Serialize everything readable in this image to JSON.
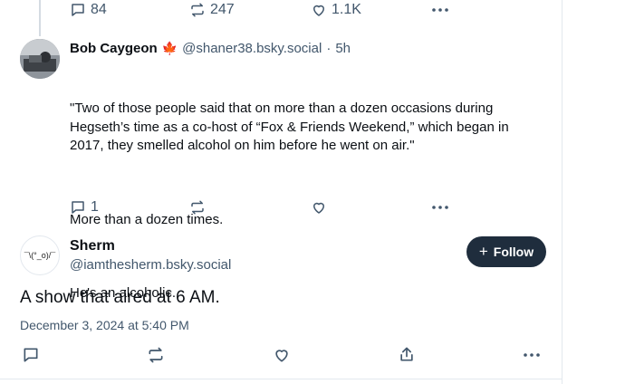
{
  "top_actions": {
    "replies": "84",
    "reposts": "247",
    "likes": "1.1K"
  },
  "reply_post": {
    "author_name": "Bob Caygeon",
    "author_emoji": "🍁",
    "handle": "@shaner38.bsky.social",
    "separator": "·",
    "time": "5h",
    "paragraphs": [
      "\"Two of those people said that on more than a dozen occasions during Hegseth’s time as a co-host of “Fox & Friends Weekend,” which began in 2017, they smelled alcohol on him before he went on air.\"",
      "More than a dozen times.",
      "He's an alcoholic."
    ],
    "replies": "1"
  },
  "main_post": {
    "author_name": "Sherm",
    "handle": "@iamthesherm.bsky.social",
    "avatar_text": "¯\\(°_o)/¯",
    "follow_label": "Follow",
    "follow_plus": "+",
    "text": "A show that aired at 6 AM.",
    "timestamp": "December 3, 2024 at 5:40 PM"
  },
  "colors": {
    "accent_dark": "#1f2d3d",
    "muted": "#42576c",
    "maple": "#d6204d"
  }
}
